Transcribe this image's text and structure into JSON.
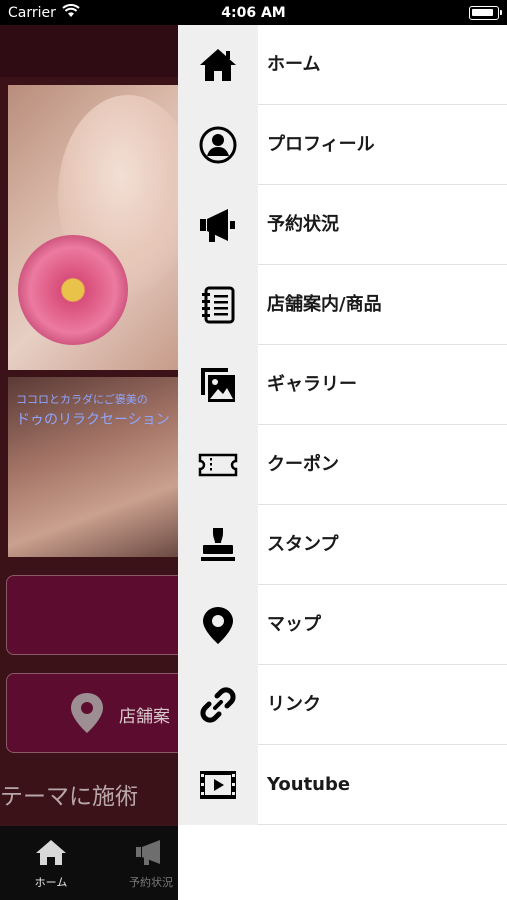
{
  "status_bar": {
    "carrier": "Carrier",
    "time": "4:06 AM"
  },
  "background_app": {
    "caption_line1": "ココロとカラダにご褒美の",
    "caption_line2": "ドゥのリラクセーション",
    "shop_button_label": "店舗案",
    "theme_text": "テーマに施術",
    "tabs": [
      {
        "label": "ホーム",
        "icon": "home-icon"
      },
      {
        "label": "予約状況",
        "icon": "megaphone-icon"
      }
    ]
  },
  "menu": {
    "items": [
      {
        "label": "ホーム",
        "icon": "home-icon"
      },
      {
        "label": "プロフィール",
        "icon": "profile-icon"
      },
      {
        "label": "予約状況",
        "icon": "megaphone-icon"
      },
      {
        "label": "店舗案内/商品",
        "icon": "notebook-icon"
      },
      {
        "label": "ギャラリー",
        "icon": "gallery-icon"
      },
      {
        "label": "クーポン",
        "icon": "coupon-icon"
      },
      {
        "label": "スタンプ",
        "icon": "stamp-icon"
      },
      {
        "label": "マップ",
        "icon": "map-pin-icon"
      },
      {
        "label": "リンク",
        "icon": "link-icon"
      },
      {
        "label": "Youtube",
        "icon": "video-icon"
      }
    ]
  },
  "colors": {
    "overlay_bg": "#3a1218",
    "button_bg": "#5c0c2e",
    "icon_cell_bg": "#efefef",
    "icon_color": "#000000"
  }
}
